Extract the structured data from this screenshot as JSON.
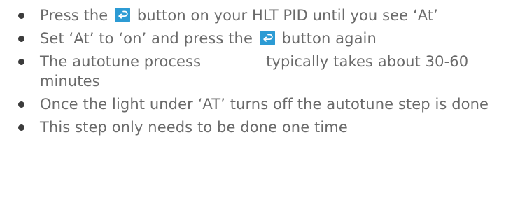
{
  "colors": {
    "text": "#6a6a6a",
    "bullet": "#3c3c3c",
    "button_icon_bg": "#2c9bd4",
    "button_icon_fg": "#ffffff"
  },
  "icons": {
    "button_icon": "return-arrow-icon"
  },
  "instructions": [
    {
      "before": "Press the",
      "after": "button on your HLT PID until you see ‘At’"
    },
    {
      "before": "Set ‘At’ to ‘on’ and press the",
      "after": "button again"
    },
    {
      "before": "The autotune process",
      "after": "typically takes about 30-60 minutes"
    },
    {
      "text": "Once the light under ‘AT’ turns off the autotune step is done"
    },
    {
      "text": "This step only needs to be done one time"
    }
  ]
}
